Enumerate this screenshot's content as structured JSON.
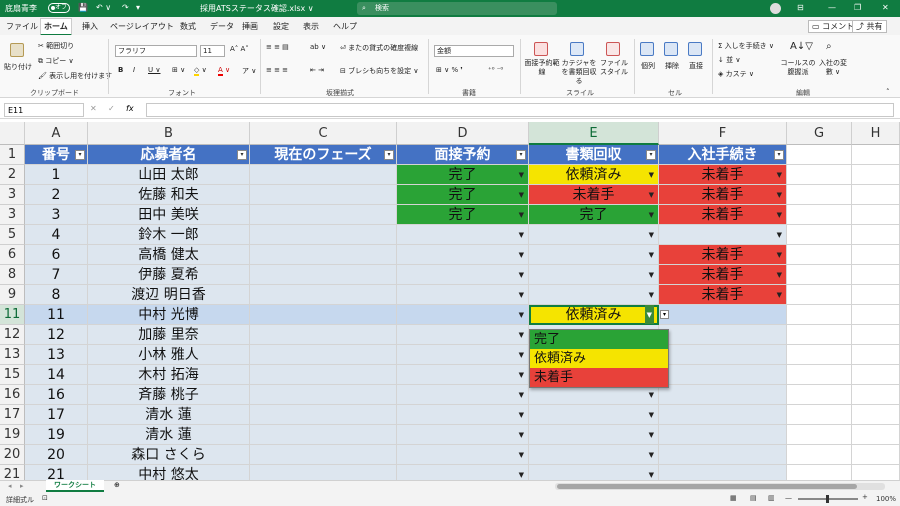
{
  "titlebar": {
    "user": "底扇青李",
    "autosave": "オフ",
    "filename": "採用ATSステータス確認.xlsx ∨",
    "search_placeholder": "検索",
    "colors": {
      "bg": "#107c41"
    }
  },
  "menu_tabs": [
    "ファイル",
    "ホーム",
    "挿入",
    "ページレイアウト",
    "数式",
    "データ",
    "挿画",
    "設定",
    "表示",
    "ヘルプ"
  ],
  "menu_right": {
    "comment": "コメント",
    "share": "共有"
  },
  "ribbon": {
    "clipboard": {
      "paste": "貼り付け",
      "cut": "範囲切り",
      "copy": "コピー ∨",
      "format_painter": "表示し用を付けます",
      "label": "クリップボード"
    },
    "font": {
      "name": "フラリフ",
      "size": "11",
      "label": "フォント"
    },
    "alignment": {
      "wrap": "またの貸式の確度複線",
      "merge": "ブレシも向ちを設定 ∨",
      "label": "坂狸揃式"
    },
    "number": {
      "format": "金額",
      "label": "書籍"
    },
    "styles": {
      "conditional": "面接予約範線",
      "table": "カテジャをを書類回収る",
      "cell": "ファイル スタイル",
      "label": "スライル"
    },
    "cells": {
      "insert": "個列",
      "delete": "挿除",
      "format": "直接",
      "label": "セル"
    },
    "editing": {
      "sum": "入しを手続き ∨",
      "fill": "並 ∨",
      "clear": "カステ ∨",
      "sort": "コールスの腹握派",
      "find": "入社の変數 ∨",
      "label": "編輯"
    }
  },
  "formula_bar": {
    "name_box": "E11",
    "fx": "fx",
    "value": ""
  },
  "columns": [
    "A",
    "B",
    "C",
    "D",
    "E",
    "F",
    "G",
    "H"
  ],
  "selected_col": "E",
  "header_row": {
    "row": "1",
    "A": "番号",
    "B": "応募者名",
    "C": "現在のフェーズ",
    "D": "面接予約",
    "E": "書類回収",
    "F": "入社手続き"
  },
  "rows": [
    {
      "row": "2",
      "A": "1",
      "B": "山田 太郎",
      "D": "完了",
      "E": "依頼済み",
      "F": "未着手"
    },
    {
      "row": "3",
      "A": "2",
      "B": "佐藤 和夫",
      "D": "完了",
      "E": "未着手",
      "F": "未着手"
    },
    {
      "row": "3",
      "A": "3",
      "B": "田中 美咲",
      "D": "完了",
      "E": "完了",
      "F": "未着手"
    },
    {
      "row": "5",
      "A": "4",
      "B": "鈴木 一郎",
      "D": "",
      "E": "",
      "F": ""
    },
    {
      "row": "6",
      "A": "6",
      "B": "高橋 健太",
      "D": "",
      "E": "",
      "F": "未着手"
    },
    {
      "row": "8",
      "A": "7",
      "B": "伊藤 夏希",
      "D": "",
      "E": "",
      "F": "未着手"
    },
    {
      "row": "9",
      "A": "8",
      "B": "渡辺 明日香",
      "D": "",
      "E": "",
      "F": "未着手"
    },
    {
      "row": "11",
      "A": "11",
      "B": "中村 光博",
      "D": "",
      "E": "依頼済み",
      "F": ""
    },
    {
      "row": "12",
      "A": "12",
      "B": "加藤 里奈",
      "D": "",
      "E": "",
      "F": ""
    },
    {
      "row": "13",
      "A": "13",
      "B": "小林 雅人",
      "D": "",
      "E": "",
      "F": ""
    },
    {
      "row": "15",
      "A": "14",
      "B": "木村 拓海",
      "D": "",
      "E": "",
      "F": ""
    },
    {
      "row": "16",
      "A": "16",
      "B": "斉藤 桃子",
      "D": "",
      "E": "",
      "F": ""
    },
    {
      "row": "17",
      "A": "17",
      "B": "清水 蓮",
      "D": "",
      "E": "",
      "F": ""
    },
    {
      "row": "19",
      "A": "19",
      "B": "清水 蓮",
      "D": "",
      "E": "",
      "F": ""
    },
    {
      "row": "20",
      "A": "20",
      "B": "森口 さくら",
      "D": "",
      "E": "",
      "F": ""
    },
    {
      "row": "21",
      "A": "21",
      "B": "中村 悠太",
      "D": "",
      "E": "",
      "F": ""
    }
  ],
  "status_colors": {
    "完了": "#2aa336",
    "依頼済み": "#f5e400",
    "未着手": "#e8413a"
  },
  "dropdown_options": [
    {
      "label": "完了",
      "color": "#2aa336"
    },
    {
      "label": "依頼済み",
      "color": "#f5e400"
    },
    {
      "label": "未着手",
      "color": "#e8413a"
    }
  ],
  "sheet_tab": "ワークシート",
  "statusbar": {
    "mode": "詳細式ル",
    "zoom": "100%"
  }
}
